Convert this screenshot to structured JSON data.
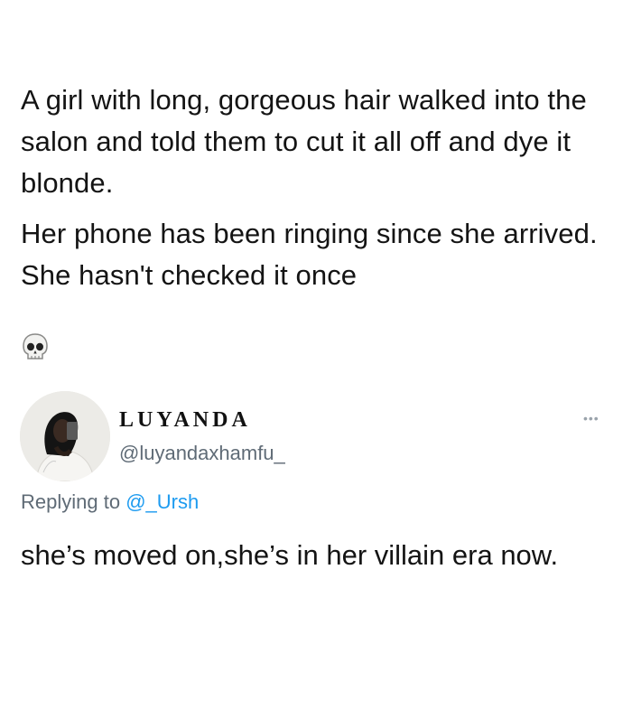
{
  "tweet": {
    "paragraph_1": "A girl with long, gorgeous hair walked into the salon and told them to cut it all off and dye it blonde.",
    "paragraph_2": "Her phone has been ringing since she arrived. She hasn't checked it once",
    "emoji": "skull-emoji"
  },
  "reply": {
    "display_name": "LUYANDA",
    "handle": "@luyandaxhamfu_",
    "more_icon": "more-options-icon",
    "replying_prefix": "Replying to",
    "replying_to": "@_Ursh",
    "text": "she’s moved on,she’s in her villain era now."
  },
  "colors": {
    "text": "#141414",
    "secondary": "#5f6b76",
    "mention": "#1d9bf0"
  }
}
